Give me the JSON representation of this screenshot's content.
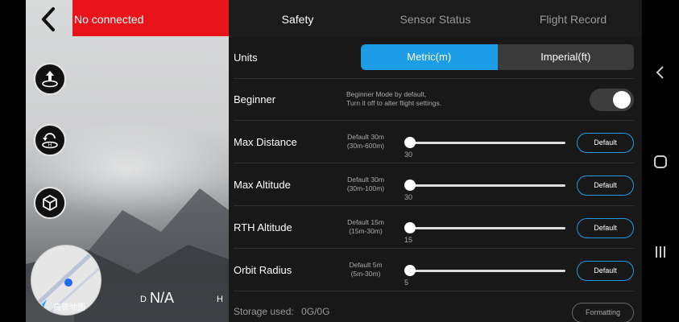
{
  "status": {
    "connection_text": "No connected"
  },
  "camera": {
    "map_label": "高德地图",
    "distance_label": "D",
    "distance_value": "N/A",
    "height_label": "H"
  },
  "tabs": [
    {
      "label": "Safety",
      "active": true
    },
    {
      "label": "Sensor Status",
      "active": false
    },
    {
      "label": "Flight Record",
      "active": false
    }
  ],
  "settings": {
    "units": {
      "label": "Units",
      "options": [
        "Metric(m)",
        "Imperial(ft)"
      ],
      "selected": "Metric(m)"
    },
    "beginner": {
      "label": "Beginner",
      "description_line1": "Beginner Mode by default,",
      "description_line2": "Turn it off to alter flight settings.",
      "enabled": false
    },
    "max_distance": {
      "label": "Max Distance",
      "default_line1": "Default 30m",
      "default_line2": "(30m-600m)",
      "value": "30",
      "button": "Default"
    },
    "max_altitude": {
      "label": "Max Altitude",
      "default_line1": "Default 30m",
      "default_line2": "(30m-100m)",
      "value": "30",
      "button": "Default"
    },
    "rth_altitude": {
      "label": "RTH Altitude",
      "default_line1": "Default 15m",
      "default_line2": "(15m-30m)",
      "value": "15",
      "button": "Default"
    },
    "orbit_radius": {
      "label": "Orbit Radius",
      "default_line1": "Default 5m",
      "default_line2": "(5m-30m)",
      "value": "5",
      "button": "Default"
    }
  },
  "storage": {
    "label": "Storage used:",
    "value": "0G/0G",
    "format_button": "Formatting"
  },
  "colors": {
    "accent": "#1c9de6",
    "alert": "#e8141a",
    "panel": "#181818"
  },
  "icons": [
    "back-arrow-icon",
    "takeoff-icon",
    "return-home-icon",
    "cube-icon",
    "location-arrow-icon",
    "nav-back-icon",
    "nav-home-icon",
    "nav-recents-icon"
  ]
}
